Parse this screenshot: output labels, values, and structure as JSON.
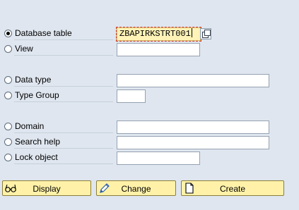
{
  "options": [
    {
      "key": "database_table",
      "label": "Database table",
      "selected": true,
      "value": "ZBAPIRKSTRT001"
    },
    {
      "key": "view",
      "label": "View",
      "selected": false,
      "value": ""
    },
    {
      "key": "data_type",
      "label": "Data type",
      "selected": false,
      "value": ""
    },
    {
      "key": "type_group",
      "label": "Type Group",
      "selected": false,
      "value": ""
    },
    {
      "key": "domain",
      "label": "Domain",
      "selected": false,
      "value": ""
    },
    {
      "key": "search_help",
      "label": "Search help",
      "selected": false,
      "value": ""
    },
    {
      "key": "lock_object",
      "label": "Lock object",
      "selected": false,
      "value": ""
    }
  ],
  "buttons": {
    "display": {
      "label": "Display",
      "icon": "glasses-icon"
    },
    "change": {
      "label": "Change",
      "icon": "pencil-icon"
    },
    "create": {
      "label": "Create",
      "icon": "blank-document-icon"
    }
  },
  "colors": {
    "background": "#dfe6ef",
    "button": "#fff2a8",
    "active_field": "#fff3b7"
  }
}
